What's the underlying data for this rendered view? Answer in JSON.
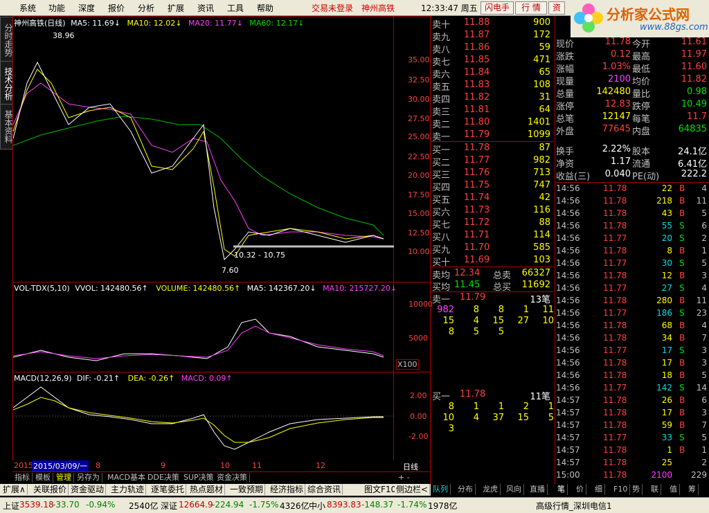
{
  "menu": {
    "items": [
      "系统",
      "功能",
      "深度",
      "报价",
      "分析",
      "扩展",
      "资讯",
      "工具",
      "帮助"
    ],
    "not_logged_in": "交易未登录",
    "stock_name": "神州高铁",
    "clock": "12:33:47 周五",
    "btn_flash": "闪电手",
    "btn_quote": "行 情",
    "btn_info": "资"
  },
  "logo": {
    "title": "分析家公式网",
    "url": "www.88gs.com"
  },
  "left_tabs": [
    "分时走势",
    "技术分析",
    "基本资料"
  ],
  "kline": {
    "title": "神州高铁(日线)",
    "ma5": "MA5: 11.69↓",
    "ma10": "MA10: 12.02↓",
    "ma20": "MA20: 11.77↓",
    "ma60": "MA60: 12.17↓",
    "price_axis": [
      "35.00",
      "32.50",
      "30.00",
      "27.50",
      "25.00",
      "22.50",
      "20.00",
      "17.50",
      "15.00",
      "12.50",
      "10.00"
    ],
    "high_label": "38.96",
    "low_label": "7.60",
    "range_label": "10.32 - 10.75"
  },
  "volume": {
    "title": "VOL-TDX(5,10)",
    "vvol": "VVOL: 142480.56↑",
    "volume": "VOLUME: 142480.56↑",
    "ma5": "MA5: 142367.20↓",
    "ma10": "MA10: 215727.20↓",
    "axis": [
      "10000",
      "5000"
    ],
    "unit": "X100"
  },
  "macd": {
    "title": "MACD(12,26,9)",
    "dif": "DIF: -0.21↑",
    "dea": "DEA: -0.26↑",
    "macd": "MACD: 0.09↑",
    "axis": [
      "2.00",
      "0.00",
      "-2.00"
    ]
  },
  "date_axis": {
    "year": "2015",
    "cursor_date": "2015/03/09/一",
    "months": [
      "8",
      "9",
      "10",
      "11",
      "12"
    ],
    "period": "日线"
  },
  "indicator_tabs": [
    "指标",
    "模板",
    "管理",
    "另存为",
    "MACD基本",
    "DDE决策",
    "SUP决策",
    "资金决策"
  ],
  "quote": {
    "sells": [
      {
        "label": "卖十",
        "price": "11.88",
        "vol": "900"
      },
      {
        "label": "卖九",
        "price": "11.87",
        "vol": "172"
      },
      {
        "label": "卖八",
        "price": "11.86",
        "vol": "59"
      },
      {
        "label": "卖七",
        "price": "11.85",
        "vol": "471"
      },
      {
        "label": "卖六",
        "price": "11.84",
        "vol": "65"
      },
      {
        "label": "卖五",
        "price": "11.83",
        "vol": "108"
      },
      {
        "label": "卖四",
        "price": "11.82",
        "vol": "31"
      },
      {
        "label": "卖三",
        "price": "11.81",
        "vol": "64"
      },
      {
        "label": "卖二",
        "price": "11.80",
        "vol": "1401"
      },
      {
        "label": "卖一",
        "price": "11.79",
        "vol": "1099"
      }
    ],
    "buys": [
      {
        "label": "买一",
        "price": "11.78",
        "vol": "87"
      },
      {
        "label": "买二",
        "price": "11.77",
        "vol": "982"
      },
      {
        "label": "买三",
        "price": "11.76",
        "vol": "713"
      },
      {
        "label": "买四",
        "price": "11.75",
        "vol": "747"
      },
      {
        "label": "买五",
        "price": "11.74",
        "vol": "42"
      },
      {
        "label": "买六",
        "price": "11.73",
        "vol": "116"
      },
      {
        "label": "买七",
        "price": "11.72",
        "vol": "88"
      },
      {
        "label": "买八",
        "price": "11.71",
        "vol": "114"
      },
      {
        "label": "买九",
        "price": "11.70",
        "vol": "585"
      },
      {
        "label": "买十",
        "price": "11.69",
        "vol": "103"
      }
    ],
    "avg_sell_label": "卖均",
    "avg_sell": "12.34",
    "total_sell_label": "总卖",
    "total_sell": "66327",
    "avg_buy_label": "买均",
    "avg_buy": "11.45",
    "total_buy_label": "总买",
    "total_buy": "11692",
    "sell_one_label": "卖一",
    "sell_one_price": "11.79",
    "sell_one_count": "13笔",
    "sell_queue": [
      [
        "982",
        "8",
        "8",
        "1",
        "11"
      ],
      [
        "15",
        "4",
        "15",
        "27",
        "10"
      ],
      [
        "8",
        "5",
        "5",
        "",
        ""
      ]
    ],
    "buy_one_label": "买一",
    "buy_one_price": "11.78",
    "buy_one_count": "11笔",
    "buy_queue": [
      [
        "8",
        "1",
        "1",
        "2",
        "1"
      ],
      [
        "10",
        "4",
        "37",
        "15",
        "5"
      ],
      [
        "3",
        "",
        "",
        "",
        ""
      ]
    ],
    "tabs": [
      "队列",
      "分布",
      "龙虎",
      "风向",
      "直播"
    ]
  },
  "stats": [
    {
      "l1": "现价",
      "v1": "11.78",
      "l2": "今开",
      "v2": "11.61"
    },
    {
      "l1": "涨跌",
      "v1": "0.12",
      "l2": "最高",
      "v2": "11.97"
    },
    {
      "l1": "涨幅",
      "v1": "1.03%",
      "l2": "最低",
      "v2": "11.60"
    },
    {
      "l1": "现量",
      "v1": "2100",
      "l2": "均价",
      "v2": "11.82"
    },
    {
      "l1": "总量",
      "v1": "142480",
      "l2": "量比",
      "v2": "0.98"
    },
    {
      "l1": "涨停",
      "v1": "12.83",
      "l2": "跌停",
      "v2": "10.49"
    },
    {
      "l1": "总笔",
      "v1": "12147",
      "l2": "每笔",
      "v2": "11.7"
    },
    {
      "l1": "外盘",
      "v1": "77645",
      "l2": "内盘",
      "v2": "64835"
    },
    {
      "l1": "换手",
      "v1": "2.22%",
      "l2": "股本",
      "v2": "24.1亿"
    },
    {
      "l1": "净资",
      "v1": "1.17",
      "l2": "流通",
      "v2": "6.41亿"
    },
    {
      "l1": "收益(三)",
      "v1": "0.040",
      "l2": "PE(动)",
      "v2": "222.2"
    }
  ],
  "ticks": [
    {
      "t": "14:56",
      "p": "11.78",
      "v": "22",
      "s": "B",
      "n": "4"
    },
    {
      "t": "14:56",
      "p": "11.78",
      "v": "218",
      "s": "B",
      "n": "11"
    },
    {
      "t": "14:56",
      "p": "11.78",
      "v": "43",
      "s": "B",
      "n": "5"
    },
    {
      "t": "14:56",
      "p": "11.78",
      "v": "55",
      "s": "S",
      "n": "6"
    },
    {
      "t": "14:56",
      "p": "11.77",
      "v": "20",
      "s": "S",
      "n": "2"
    },
    {
      "t": "14:56",
      "p": "11.78",
      "v": "8",
      "s": "B",
      "n": "1"
    },
    {
      "t": "14:56",
      "p": "11.77",
      "v": "30",
      "s": "S",
      "n": "5"
    },
    {
      "t": "14:56",
      "p": "11.78",
      "v": "12",
      "s": "B",
      "n": "3"
    },
    {
      "t": "14:56",
      "p": "11.77",
      "v": "27",
      "s": "S",
      "n": "4"
    },
    {
      "t": "14:56",
      "p": "11.78",
      "v": "280",
      "s": "B",
      "n": "11"
    },
    {
      "t": "14:56",
      "p": "11.77",
      "v": "186",
      "s": "S",
      "n": "23"
    },
    {
      "t": "14:56",
      "p": "11.78",
      "v": "68",
      "s": "B",
      "n": "4"
    },
    {
      "t": "14:56",
      "p": "11.78",
      "v": "34",
      "s": "B",
      "n": "7"
    },
    {
      "t": "14:56",
      "p": "11.77",
      "v": "17",
      "s": "S",
      "n": "3"
    },
    {
      "t": "14:56",
      "p": "11.78",
      "v": "17",
      "s": "B",
      "n": "3"
    },
    {
      "t": "14:56",
      "p": "11.78",
      "v": "18",
      "s": "B",
      "n": "5"
    },
    {
      "t": "14:56",
      "p": "11.77",
      "v": "142",
      "s": "S",
      "n": "14"
    },
    {
      "t": "14:57",
      "p": "11.78",
      "v": "26",
      "s": "B",
      "n": "6"
    },
    {
      "t": "14:57",
      "p": "11.78",
      "v": "17",
      "s": "B",
      "n": "3"
    },
    {
      "t": "14:57",
      "p": "11.78",
      "v": "59",
      "s": "B",
      "n": "7"
    },
    {
      "t": "14:57",
      "p": "11.77",
      "v": "33",
      "s": "S",
      "n": "5"
    },
    {
      "t": "14:57",
      "p": "11.78",
      "v": "1",
      "s": "B",
      "n": "1"
    },
    {
      "t": "14:57",
      "p": "11.78",
      "v": "25",
      "s": "",
      "n": "2"
    },
    {
      "t": "15:00",
      "p": "11.78",
      "v": "2100",
      "s": "",
      "n": "229"
    }
  ],
  "tick_tabs": [
    "笔",
    "价",
    "细",
    "F10",
    "势",
    "联",
    "值",
    "筹"
  ],
  "func_tabs": [
    "扩展∧",
    "关联报价",
    "资金驱动",
    "主力轨迹",
    "逐笔委托",
    "热点题材",
    "一致预期",
    "经济指标",
    "综合资讯",
    "图文F10",
    "侧边栏<"
  ],
  "status": {
    "sh_label": "上证",
    "sh": "3539.18",
    "sh_chg": "-33.70",
    "sh_pct": "-0.94%",
    "sh_amt": "2540亿",
    "sz_label": "深证",
    "sz": "12664.9",
    "sz_chg": "-224.94",
    "sz_pct": "-1.75%",
    "sz_amt": "4326亿",
    "zx_label": "中小",
    "zx": "8393.83",
    "zx_chg": "-148.37",
    "zx_pct": "-1.74%",
    "zx_amt": "1978亿",
    "server": "高级行情_深圳电信1"
  },
  "colors": {
    "up": "#ff4040",
    "down": "#00e0e0",
    "bg": "#000000",
    "border": "#b00000"
  }
}
